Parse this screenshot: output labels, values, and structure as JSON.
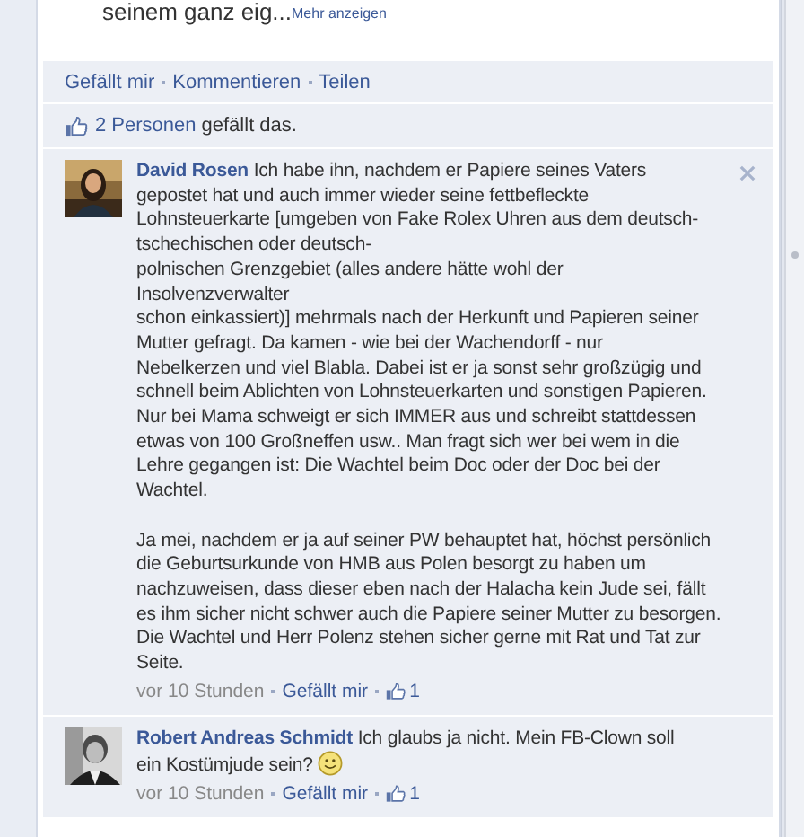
{
  "post": {
    "text": "seinem ganz eig...",
    "more_link": "Mehr anzeigen"
  },
  "actions": [
    "Gefällt mir",
    "Kommentieren",
    "Teilen"
  ],
  "likes": {
    "people": "2 Personen",
    "text": "gefällt das."
  },
  "comments": [
    {
      "author": "David Rosen",
      "text": "Ich habe ihn, nachdem er Papiere seines Vaters\ngepostet hat und auch immer wieder seine fettbefleckte\nLohnsteuerkarte [umgeben von Fake Rolex Uhren aus dem deutsch-\ntschechischen oder deutsch-\npolnischen Grenzgebiet (alles andere hätte wohl der\nInsolvenzverwalter\nschon einkassiert)] mehrmals nach der Herkunft und Papieren seiner\nMutter gefragt. Da kamen - wie bei der Wachendorff - nur\nNebelkerzen und viel Blabla. Dabei ist er ja sonst sehr großzügig und\nschnell beim Ablichten von Lohnsteuerkarten und sonstigen Papieren.\nNur bei Mama schweigt er sich IMMER aus und schreibt stattdessen\netwas von 100 Großneffen usw.. Man fragt sich wer bei wem in die\nLehre gegangen ist: Die Wachtel beim Doc oder der Doc bei der\nWachtel.\n\nJa mei, nachdem er ja auf seiner PW behauptet hat, höchst persönlich\ndie Geburtsurkunde von HMB aus Polen besorgt zu haben um\nnachzuweisen, dass dieser eben nach der Halacha kein Jude sei, fällt\nes ihm sicher nicht schwer auch die Papiere seiner Mutter zu besorgen.\nDie Wachtel und Herr Polenz stehen sicher gerne mit Rat und Tat zur\nSeite.",
      "smiley": false,
      "time": "vor 10 Stunden",
      "like": "Gefällt mir",
      "like_count": "1",
      "removable": true
    },
    {
      "author": "Robert Andreas Schmidt",
      "text": "Ich glaubs ja nicht. Mein FB-Clown soll\nein Kostümjude sein?",
      "smiley": true,
      "time": "vor 10 Stunden",
      "like": "Gefällt mir",
      "like_count": "1",
      "removable": false
    }
  ]
}
